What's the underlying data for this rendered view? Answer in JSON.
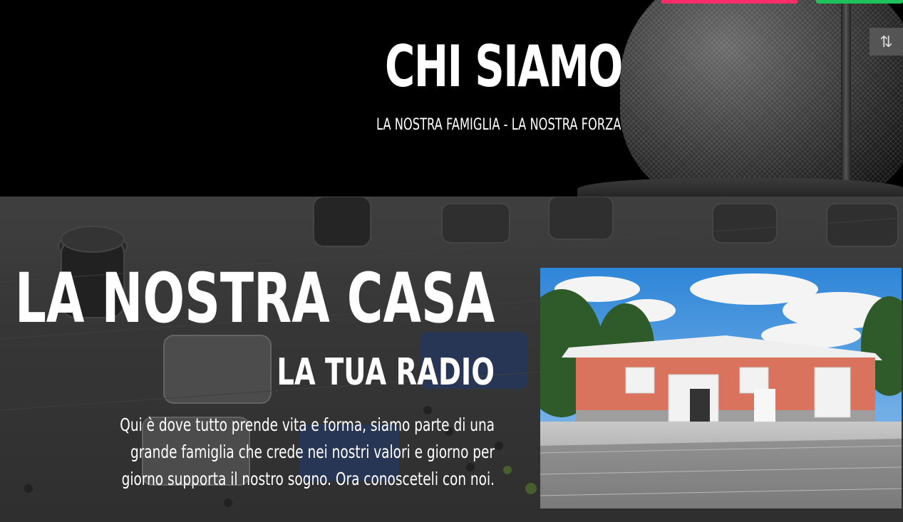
{
  "hero": {
    "title": "CHI SIAMO",
    "subtitle": "LA NOSTRA FAMIGLIA - LA NOSTRA FORZA"
  },
  "header_buttons": {
    "accent_pink": "#ff2d6a",
    "accent_green": "#1fc25a"
  },
  "scroll_toggle": {
    "icon": "up-down-arrows-icon",
    "glyph": "⇅"
  },
  "section": {
    "title": "LA NOSTRA CASA",
    "subtitle": "LA TUA RADIO",
    "text_lines": [
      "Qui è dove tutto prende vita e forma, siamo parte di una",
      "grande famiglia che crede nei nostri valori e giorno per",
      "giorno supporta il nostro sogno. Ora conosceteli con noi."
    ]
  }
}
